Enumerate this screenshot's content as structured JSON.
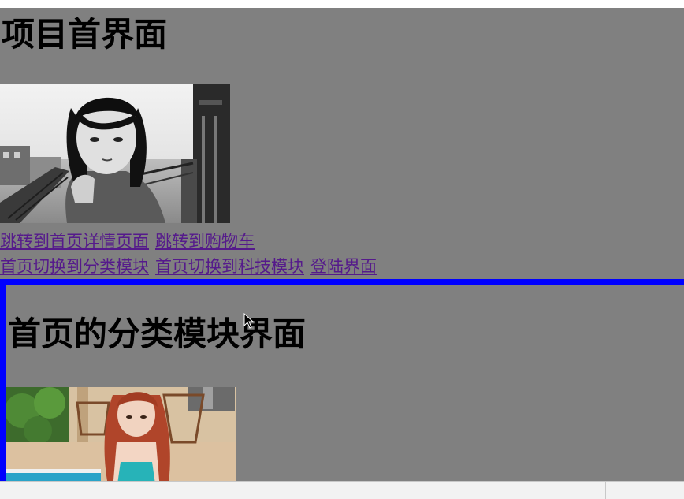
{
  "page": {
    "title": "项目首界面",
    "links_row1": [
      {
        "label": "跳转到首页详情页面"
      },
      {
        "label": "跳转到购物车"
      }
    ],
    "links_row2": [
      {
        "label": "首页切换到分类模块"
      },
      {
        "label": "首页切换到科技模块"
      },
      {
        "label": "登陆界面"
      }
    ]
  },
  "sub_view": {
    "title": "首页的分类模块界面"
  },
  "colors": {
    "background": "#808080",
    "link": "#551a8b",
    "frame_border": "#0000ff",
    "text": "#000000"
  },
  "icons": [
    "cursor-arrow-icon"
  ]
}
